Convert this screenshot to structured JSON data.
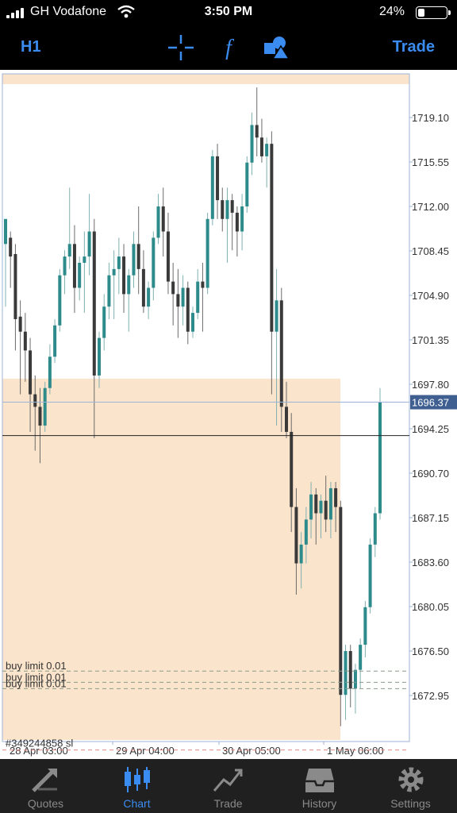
{
  "status": {
    "carrier": "GH Vodafone",
    "time": "3:50 PM",
    "battery": "24%",
    "battery_level": 0.24
  },
  "toolbar": {
    "timeframe": "H1",
    "trade_label": "Trade",
    "icons": [
      "crosshair-icon",
      "function-icon",
      "objects-icon"
    ]
  },
  "chart": {
    "type": "candlestick",
    "price_labels": [
      "1719.10",
      "1715.55",
      "1712.00",
      "1708.45",
      "1704.90",
      "1701.35",
      "1697.80",
      "1694.25",
      "1690.70",
      "1687.15",
      "1683.60",
      "1680.05",
      "1676.50",
      "1672.95"
    ],
    "time_labels": [
      "28 Apr 03:00",
      "29 Apr 04:00",
      "30 Apr 05:00",
      "1 May 06:00"
    ],
    "current_price": "1696.37",
    "order_labels": [
      "buy limit 0.01",
      "buy limit 0.01",
      "buy limit 0.01"
    ],
    "sl_label": "#349244858 sl",
    "colors": {
      "bull": "#2e8b8b",
      "bear": "#3a3a3a",
      "zone": "#fbe4cc",
      "accent": "#3b8cf0"
    }
  },
  "tabs": [
    {
      "label": "Quotes",
      "icon": "quotes-icon"
    },
    {
      "label": "Chart",
      "icon": "chart-icon",
      "active": true
    },
    {
      "label": "Trade",
      "icon": "trade-icon"
    },
    {
      "label": "History",
      "icon": "history-icon"
    },
    {
      "label": "Settings",
      "icon": "settings-icon"
    }
  ]
}
